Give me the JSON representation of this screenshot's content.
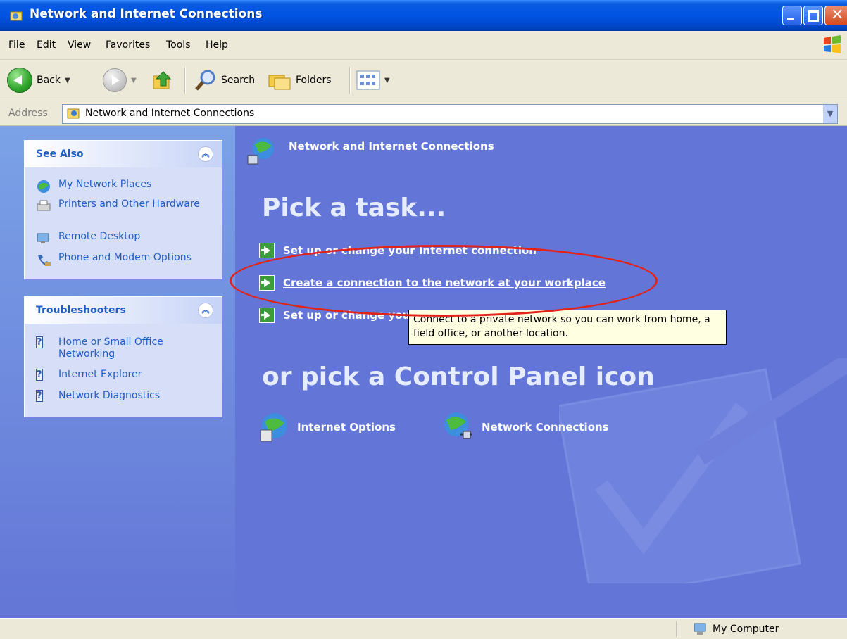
{
  "window": {
    "title": "Network and Internet Connections"
  },
  "menu": {
    "items": [
      "File",
      "Edit",
      "View",
      "Favorites",
      "Tools",
      "Help"
    ]
  },
  "toolbar": {
    "back_label": "Back",
    "search_label": "Search",
    "folders_label": "Folders"
  },
  "address": {
    "label": "Address",
    "value": "Network and Internet Connections"
  },
  "see_also": {
    "title": "See Also",
    "items": [
      {
        "label": "My Network Places",
        "icon": "network-places-icon"
      },
      {
        "label": "Printers and Other Hardware",
        "icon": "printer-icon"
      },
      {
        "label": "Remote Desktop",
        "icon": "remote-desktop-icon"
      },
      {
        "label": "Phone and Modem Options",
        "icon": "phone-modem-icon"
      }
    ]
  },
  "troubleshooters": {
    "title": "Troubleshooters",
    "items": [
      {
        "label": "Home or Small Office Networking",
        "icon": "help-icon"
      },
      {
        "label": "Internet Explorer",
        "icon": "help-icon"
      },
      {
        "label": "Network Diagnostics",
        "icon": "help-icon"
      }
    ]
  },
  "main": {
    "section_title": "Network and Internet Connections",
    "pick_task_heading": "Pick a task...",
    "tasks": [
      {
        "label": "Set up or change your Internet connection"
      },
      {
        "label": "Create a connection to the network at your workplace"
      },
      {
        "label": "Set up or change your"
      }
    ],
    "pick_icon_heading": "or pick a Control Panel icon",
    "cp_icons": [
      {
        "label": "Internet Options",
        "icon": "internet-options-icon"
      },
      {
        "label": "Network Connections",
        "icon": "network-connections-icon"
      }
    ]
  },
  "tooltip": {
    "text": "Connect to a private network so you can work from home, a field office, or another location."
  },
  "status": {
    "location": "My Computer"
  },
  "colors": {
    "titlebar": "#0054e3",
    "left_pane": "#7ba2e7",
    "main_pane": "#6375d6",
    "link": "#215dc6",
    "annotation": "#e2231a"
  }
}
